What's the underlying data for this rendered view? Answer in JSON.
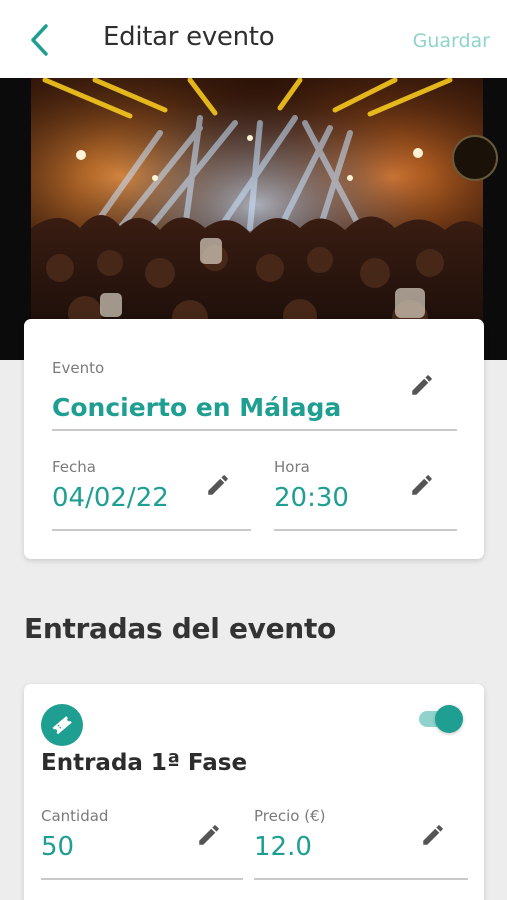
{
  "header": {
    "title": "Editar evento",
    "save_label": "Guardar"
  },
  "event": {
    "name_label": "Evento",
    "name_value": "Concierto en Málaga",
    "date_label": "Fecha",
    "date_value": "04/02/22",
    "time_label": "Hora",
    "time_value": "20:30"
  },
  "tickets": {
    "section_title": "Entradas del evento",
    "items": [
      {
        "name": "Entrada 1ª Fase",
        "enabled": true,
        "quantity_label": "Cantidad",
        "quantity_value": "50",
        "price_label": "Precio (€)",
        "price_value": "12.0"
      }
    ]
  },
  "colors": {
    "accent": "#1f9f92",
    "accent_light": "#8fd3cc",
    "background": "#ededed"
  },
  "icons": [
    "back-arrow-icon",
    "pencil-icon",
    "ticket-icon"
  ]
}
